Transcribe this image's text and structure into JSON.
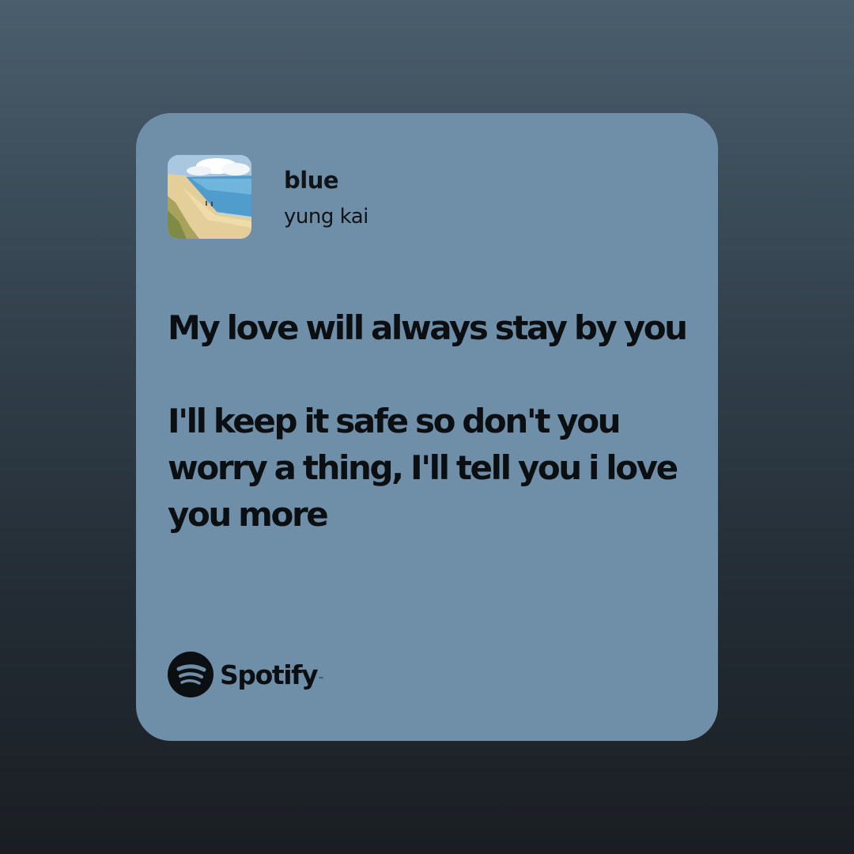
{
  "share_card": {
    "track": {
      "title": "blue",
      "artist": "yung kai",
      "artwork_icon": "album-art-beach-painting"
    },
    "lyrics": "My love will always stay by you\n\nI'll keep it safe so don't you worry a thing, I'll tell you i love you more",
    "brand": {
      "name": "Spotify",
      "trademark": "™",
      "logo_icon": "spotify-logo-icon"
    },
    "colors": {
      "card_background": "#6f8fa9",
      "text": "#0c0f12",
      "page_gradient_top": "#4a5e6d",
      "page_gradient_bottom": "#1a1e23"
    }
  }
}
